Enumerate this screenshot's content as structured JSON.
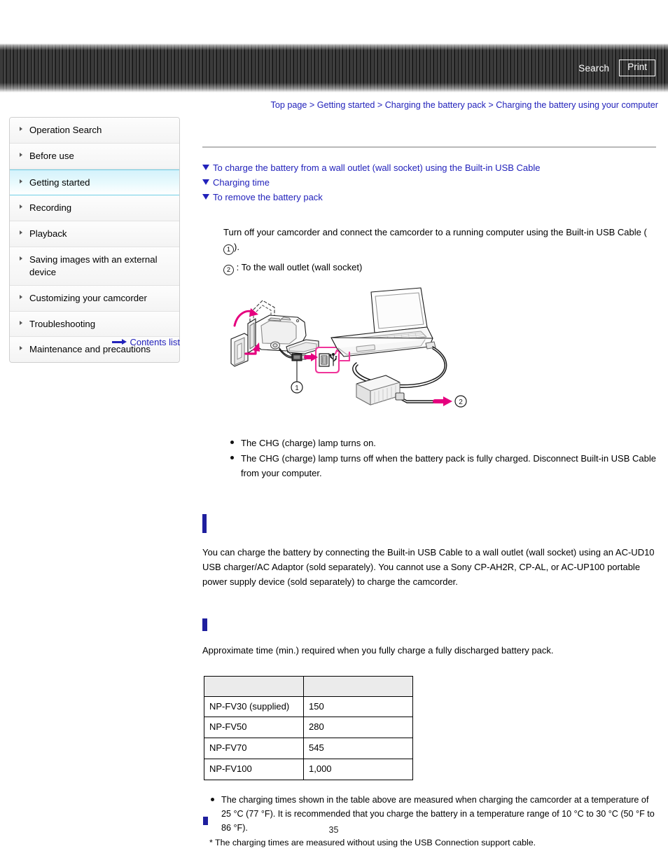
{
  "header": {
    "search_label": "Search",
    "print_label": "Print",
    "search_icon": "search-icon",
    "print_icon": "print-icon"
  },
  "breadcrumb": {
    "separator": ">",
    "items": [
      "Top page",
      "Getting started",
      "Charging the battery pack",
      "Charging the battery using your computer"
    ]
  },
  "sidebar": {
    "items": [
      {
        "label": "Operation Search",
        "active": false
      },
      {
        "label": "Before use",
        "active": false
      },
      {
        "label": "Getting started",
        "active": true
      },
      {
        "label": "Recording",
        "active": false
      },
      {
        "label": "Playback",
        "active": false
      },
      {
        "label": "Saving images with an external device",
        "active": false
      },
      {
        "label": "Customizing your camcorder",
        "active": false
      },
      {
        "label": "Troubleshooting",
        "active": false
      },
      {
        "label": "Maintenance and precautions",
        "active": false
      }
    ],
    "contents_list_label": "Contents list",
    "contents_list_icon": "arrow-right-icon"
  },
  "main": {
    "jump_links": [
      "To charge the battery from a wall outlet (wall socket) using the Built-in USB Cable",
      "Charging time",
      "To remove the battery pack"
    ],
    "jump_link_icon": "triangle-down-icon",
    "step": {
      "line1_a": "Turn off your camcorder and connect the camcorder to a running computer using the Built-in USB Cable (",
      "marker1": "1",
      "line1_b": ").",
      "marker2": "2",
      "line2": ": To the wall outlet (wall socket)"
    },
    "illustration": {
      "name": "camcorder-usb-charging-diagram",
      "callout_1": "1",
      "callout_2": "2",
      "usb_symbol": "usb-icon"
    },
    "chg_bullets": [
      "The CHG (charge) lamp turns on.",
      "The CHG (charge) lamp turns off when the battery pack is fully charged. Disconnect Built-in USB Cable from your computer."
    ],
    "section_wall_outlet": {
      "heading": "",
      "body": "You can charge the battery by connecting the Built-in USB Cable to a wall outlet (wall socket) using an AC-UD10 USB charger/AC Adaptor (sold separately). You cannot use a Sony CP-AH2R, CP-AL, or AC-UP100 portable power supply device (sold separately) to charge the camcorder."
    },
    "section_charging_time": {
      "heading": "",
      "intro": "Approximate time (min.) required when you fully charge a fully discharged battery pack."
    }
  },
  "table": {
    "headers": [
      "",
      ""
    ],
    "rows": [
      [
        "NP-FV30 (supplied)",
        "150"
      ],
      [
        "NP-FV50",
        "280"
      ],
      [
        "NP-FV70",
        "545"
      ],
      [
        "NP-FV100",
        "1,000"
      ]
    ]
  },
  "notes": {
    "bullet": "The charging times shown in the table above are measured when charging the camcorder at a temperature of 25 °C (77 °F). It is recommended that you charge the battery in a temperature range of 10 °C to 30 °C (50 °F to 86 °F).",
    "footnote": "* The charging times are measured without using the USB Connection support cable."
  },
  "page_number": "35",
  "colors": {
    "link": "#2222bb",
    "marker": "#1f1f9e",
    "active_sidebar": "#d4f2fb",
    "illustration_accent": "#e5007e"
  }
}
